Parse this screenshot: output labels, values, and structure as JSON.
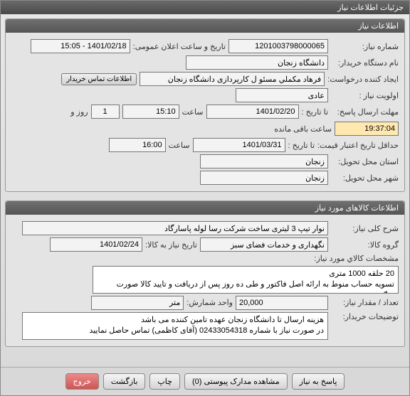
{
  "window": {
    "title": "جزئیات اطلاعات نیاز"
  },
  "section1": {
    "header": "اطلاعات نیاز",
    "need_no_label": "شماره نیاز:",
    "need_no": "1201003798000065",
    "announce_dt_label": "تاریخ و ساعت اعلان عمومی:",
    "announce_dt": "1401/02/18 - 15:05",
    "buyer_org_label": "نام دستگاه خریدار:",
    "buyer_org": "دانشگاه زنجان",
    "requester_label": "ایجاد کننده درخواست:",
    "requester": "فرهاد مکملي مسئو ل کارپردازی دانشگاه زنجان",
    "contact_btn": "اطلاعات تماس خریدار",
    "priority_label": "اولویت نیاز :",
    "priority": "عادی",
    "deadline_label": "مهلت ارسال پاسخ:",
    "to_date_label": "تا تاریخ :",
    "to_date": "1401/02/20",
    "time_label": "ساعت",
    "to_time": "15:10",
    "days_label": "روز و",
    "days": "1",
    "countdown": "19:37:04",
    "remain_label": "ساعت باقی مانده",
    "validity_label": "حداقل تاریخ اعتبار قیمت:",
    "validity_date": "1401/03/31",
    "validity_time": "16:00",
    "province_label": "استان محل تحویل:",
    "province": "زنجان",
    "city_label": "شهر محل تحویل:",
    "city": "زنجان"
  },
  "section2": {
    "header": "اطلاعات کالاهای مورد نیاز",
    "desc_label": "شرح کلی نیاز:",
    "desc": "نوار تیپ 3 لیتری ساخت شرکت رسا لوله پاسارگاد",
    "group_label": "گروه کالا:",
    "group": "نگهداری و خدمات فضای سبز",
    "need_date_label": "تاریخ نیاز به کالا:",
    "need_date": "1401/02/24",
    "spec_label": "مشخصات کالاي مورد نیاز:",
    "spec": "20 حلقه 1000 متری\nتسویه حساب منوط به ارائه اصل فاکتور و طی ده روز پس از دریافت و تایید کالا صورت میگیرد",
    "qty_label": "تعداد / مقدار نیاز:",
    "qty": "20,000",
    "unit_label": "واحد شمارش:",
    "unit": "متر",
    "buyer_note_label": "توضیحات خریدار:",
    "buyer_note": "هزینه ارسال تا دانشگاه زنجان عهده تامین کننده می باشد\nدر صورت نیاز با شماره 02433054318 (آقای کاظمی) تماس حاصل نمایید"
  },
  "footer": {
    "reply": "پاسخ به نیاز",
    "attachments": "مشاهده مدارک پیوستی (0)",
    "print": "چاپ",
    "back": "بازگشت",
    "exit": "خروج"
  }
}
